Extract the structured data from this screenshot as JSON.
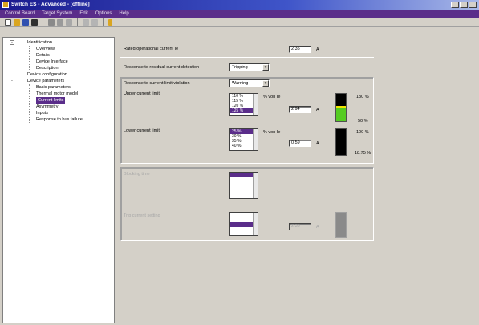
{
  "window": {
    "title": "Switch ES - Advanced - [offline]"
  },
  "menu": [
    "Control Board",
    "Target System",
    "Edit",
    "Options",
    "Help"
  ],
  "toolbar_icons": [
    "new-icon",
    "open-icon",
    "save-icon",
    "print-icon",
    "cut-icon",
    "copy-icon",
    "paste-icon",
    "undo-icon",
    "redo-icon",
    "help-icon"
  ],
  "tree": [
    {
      "label": "Identification",
      "level": 0,
      "expander": "-"
    },
    {
      "label": "Overview",
      "level": 1
    },
    {
      "label": "Details",
      "level": 1
    },
    {
      "label": "Device Interface",
      "level": 1
    },
    {
      "label": "Description",
      "level": 1
    },
    {
      "label": "Device configuration",
      "level": 0,
      "expander": ""
    },
    {
      "label": "Device parameters",
      "level": 0,
      "expander": "-"
    },
    {
      "label": "Basic parameters",
      "level": 1
    },
    {
      "label": "Thermal motor model",
      "level": 1
    },
    {
      "label": "Current limits",
      "level": 1,
      "selected": true
    },
    {
      "label": "Asymmetry",
      "level": 1
    },
    {
      "label": "Inputs",
      "level": 1
    },
    {
      "label": "Response to bus failure",
      "level": 1
    }
  ],
  "form": {
    "rated_current": {
      "label": "Rated operational current Ie",
      "value": "2.35",
      "unit": "A"
    },
    "residual_response": {
      "label": "Response to residual current detection",
      "value": "Tripping"
    },
    "limit_response": {
      "label": "Response to current limit violation",
      "value": "Warning"
    },
    "upper_limit": {
      "label": "Upper current limit",
      "options": [
        "110 %",
        "115 %",
        "120 %",
        "125 %"
      ],
      "selected": "125 %",
      "dim": "% von Ie",
      "value": "2.94",
      "unit": "A",
      "scale_top": "130 %",
      "scale_bottom": "50 %"
    },
    "lower_limit": {
      "label": "Lower current limit",
      "options": [
        "25 %",
        "30 %",
        "35 %",
        "40 %"
      ],
      "selected": "25 %",
      "dim": "% von Ie",
      "value": "0.59",
      "unit": "A",
      "scale_top": "100 %",
      "scale_bottom": "18.75 %"
    },
    "group2": {
      "label_a": "Blocking time",
      "label_b": "Trip current setting",
      "value": "2.35",
      "unit": "A"
    }
  },
  "colors": {
    "accent": "#5a2d8a",
    "bar_yellow": "#f2e600",
    "bar_green": "#55cc22"
  }
}
